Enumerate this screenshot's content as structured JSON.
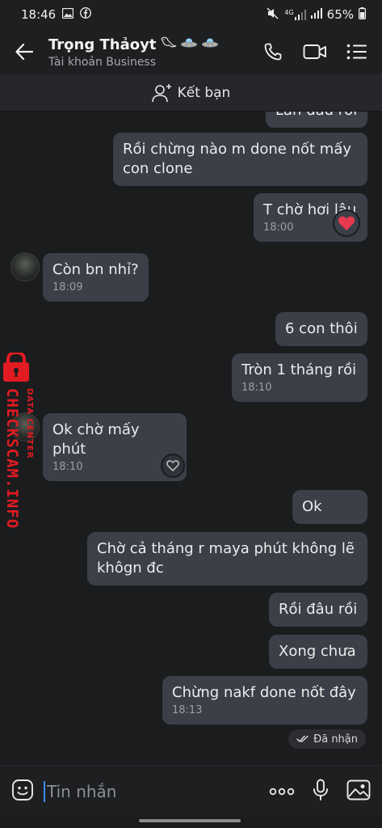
{
  "status_bar": {
    "time": "18:46",
    "battery": "65%",
    "network": "4G"
  },
  "header": {
    "title": "Trọng Thảoyt",
    "subtitle": "Tài khoản Business"
  },
  "friend_bar": {
    "label": "Kết bạn"
  },
  "messages": [
    {
      "text": "Lần đầu rồi",
      "side": "right"
    },
    {
      "text": "Rồi chừng nào m done nốt mấy con clone",
      "side": "right"
    },
    {
      "text": "T chờ hơi lâu",
      "time": "18:00",
      "side": "right",
      "reaction": "heart"
    },
    {
      "text": "Còn bn nhỉ?",
      "time": "18:09",
      "side": "left"
    },
    {
      "text": "6 con thôi",
      "side": "right"
    },
    {
      "text": "Tròn 1 tháng rồi",
      "time": "18:10",
      "side": "right"
    },
    {
      "text": "Ok chờ mấy phút",
      "time": "18:10",
      "side": "left"
    },
    {
      "text": "Ok",
      "side": "right"
    },
    {
      "text": "Chờ cả tháng r maya phút không lẽ khôgn đc",
      "side": "right"
    },
    {
      "text": "Rồi đâu rồi",
      "side": "right"
    },
    {
      "text": "Xong chưa",
      "side": "right"
    },
    {
      "text": "Chừng nakf done nốt đây",
      "time": "18:13",
      "side": "right"
    }
  ],
  "seen_status": "Đã nhận",
  "watermark": {
    "main": "CHECKSCAM.INFO",
    "sub": "DATA CENTER"
  },
  "input": {
    "placeholder": "Tin nhắn"
  },
  "colors": {
    "bubble": "#3a3f48",
    "background": "#1b1c1e",
    "watermark": "#e11b22"
  }
}
